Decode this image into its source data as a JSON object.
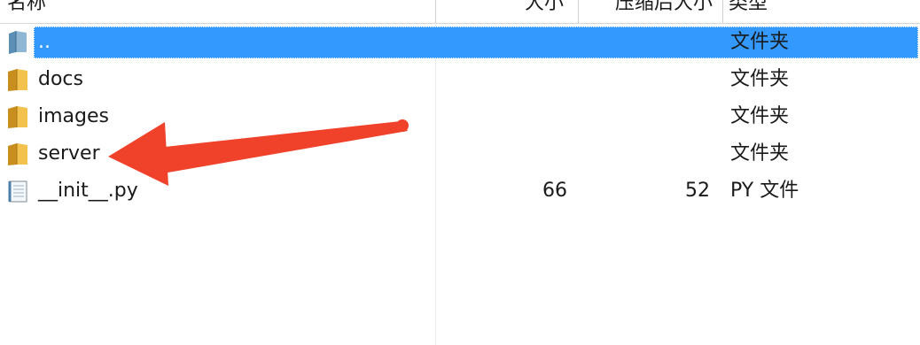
{
  "columns": {
    "name": "名称",
    "size": "大小",
    "compressed_size": "压缩后大小",
    "type": "类型"
  },
  "rows": [
    {
      "name": "..",
      "size": "",
      "compressed_size": "",
      "type": "文件夹",
      "icon": "folder-up-icon",
      "selected": true
    },
    {
      "name": "docs",
      "size": "",
      "compressed_size": "",
      "type": "文件夹",
      "icon": "folder-icon",
      "selected": false
    },
    {
      "name": "images",
      "size": "",
      "compressed_size": "",
      "type": "文件夹",
      "icon": "folder-icon",
      "selected": false
    },
    {
      "name": "server",
      "size": "",
      "compressed_size": "",
      "type": "文件夹",
      "icon": "folder-icon",
      "selected": false
    },
    {
      "name": "__init__.py",
      "size": "66",
      "compressed_size": "52",
      "type": "PY 文件",
      "icon": "python-file-icon",
      "selected": false
    }
  ],
  "colors": {
    "selection": "#3399ff",
    "folder": "#e8b23a",
    "annotation_arrow": "#f0412a"
  }
}
